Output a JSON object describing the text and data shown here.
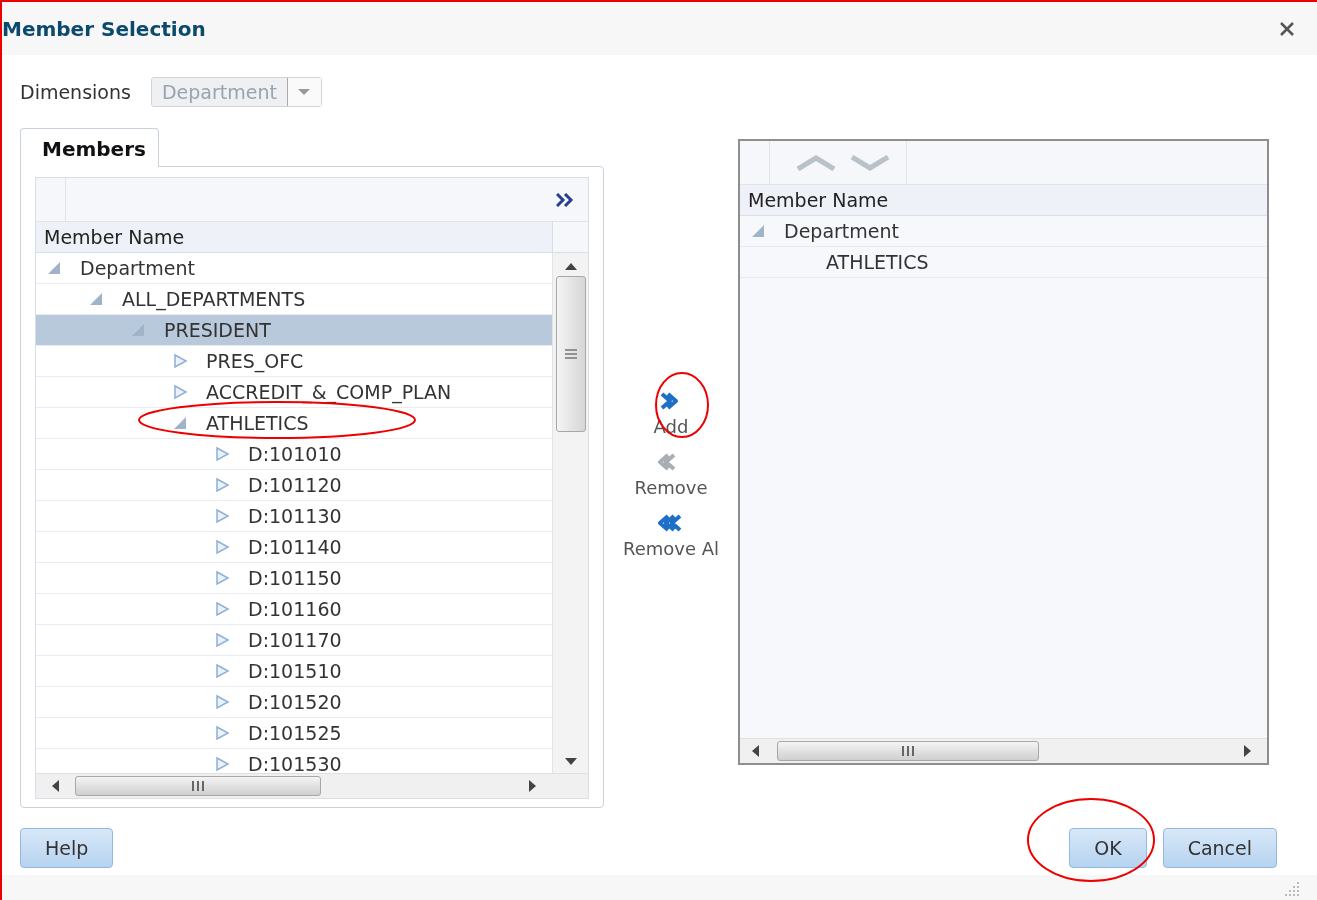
{
  "window": {
    "title": "Member Selection"
  },
  "dimensions": {
    "label": "Dimensions",
    "value": "Department",
    "disabled": true
  },
  "tabs": [
    {
      "label": "Members",
      "selected": true
    }
  ],
  "members_panel": {
    "column": "Member Name",
    "tree": [
      {
        "label": "Department",
        "expanded": true,
        "selected": false,
        "children": [
          {
            "label": "ALL_DEPARTMENTS",
            "expanded": true,
            "selected": false,
            "children": [
              {
                "label": "PRESIDENT",
                "expanded": true,
                "selected": true,
                "children": [
                  {
                    "label": "PRES_OFC",
                    "expanded": false,
                    "selected": false
                  },
                  {
                    "label": "ACCREDIT_&_COMP_PLAN",
                    "expanded": false,
                    "selected": false
                  },
                  {
                    "label": "ATHLETICS",
                    "expanded": true,
                    "selected": false,
                    "children": [
                      {
                        "label": "D:101010",
                        "expanded": false,
                        "selected": false
                      },
                      {
                        "label": "D:101120",
                        "expanded": false,
                        "selected": false
                      },
                      {
                        "label": "D:101130",
                        "expanded": false,
                        "selected": false
                      },
                      {
                        "label": "D:101140",
                        "expanded": false,
                        "selected": false
                      },
                      {
                        "label": "D:101150",
                        "expanded": false,
                        "selected": false
                      },
                      {
                        "label": "D:101160",
                        "expanded": false,
                        "selected": false
                      },
                      {
                        "label": "D:101170",
                        "expanded": false,
                        "selected": false
                      },
                      {
                        "label": "D:101510",
                        "expanded": false,
                        "selected": false
                      },
                      {
                        "label": "D:101520",
                        "expanded": false,
                        "selected": false
                      },
                      {
                        "label": "D:101525",
                        "expanded": false,
                        "selected": false
                      },
                      {
                        "label": "D:101530",
                        "expanded": false,
                        "selected": false
                      }
                    ]
                  }
                ]
              }
            ]
          }
        ]
      }
    ]
  },
  "actions": [
    {
      "kind": "add",
      "label": "Add"
    },
    {
      "kind": "remove",
      "label": "Remove"
    },
    {
      "kind": "remove_all",
      "label": "Remove Al"
    }
  ],
  "selected_panel": {
    "column": "Member Name",
    "tree": [
      {
        "label": "Department",
        "expanded": true,
        "selected": false,
        "children": [
          {
            "label": "ATHLETICS",
            "selected": false
          }
        ]
      }
    ]
  },
  "buttons": [
    {
      "label": "Help"
    },
    {
      "label": "OK"
    },
    {
      "label": "Cancel"
    }
  ]
}
